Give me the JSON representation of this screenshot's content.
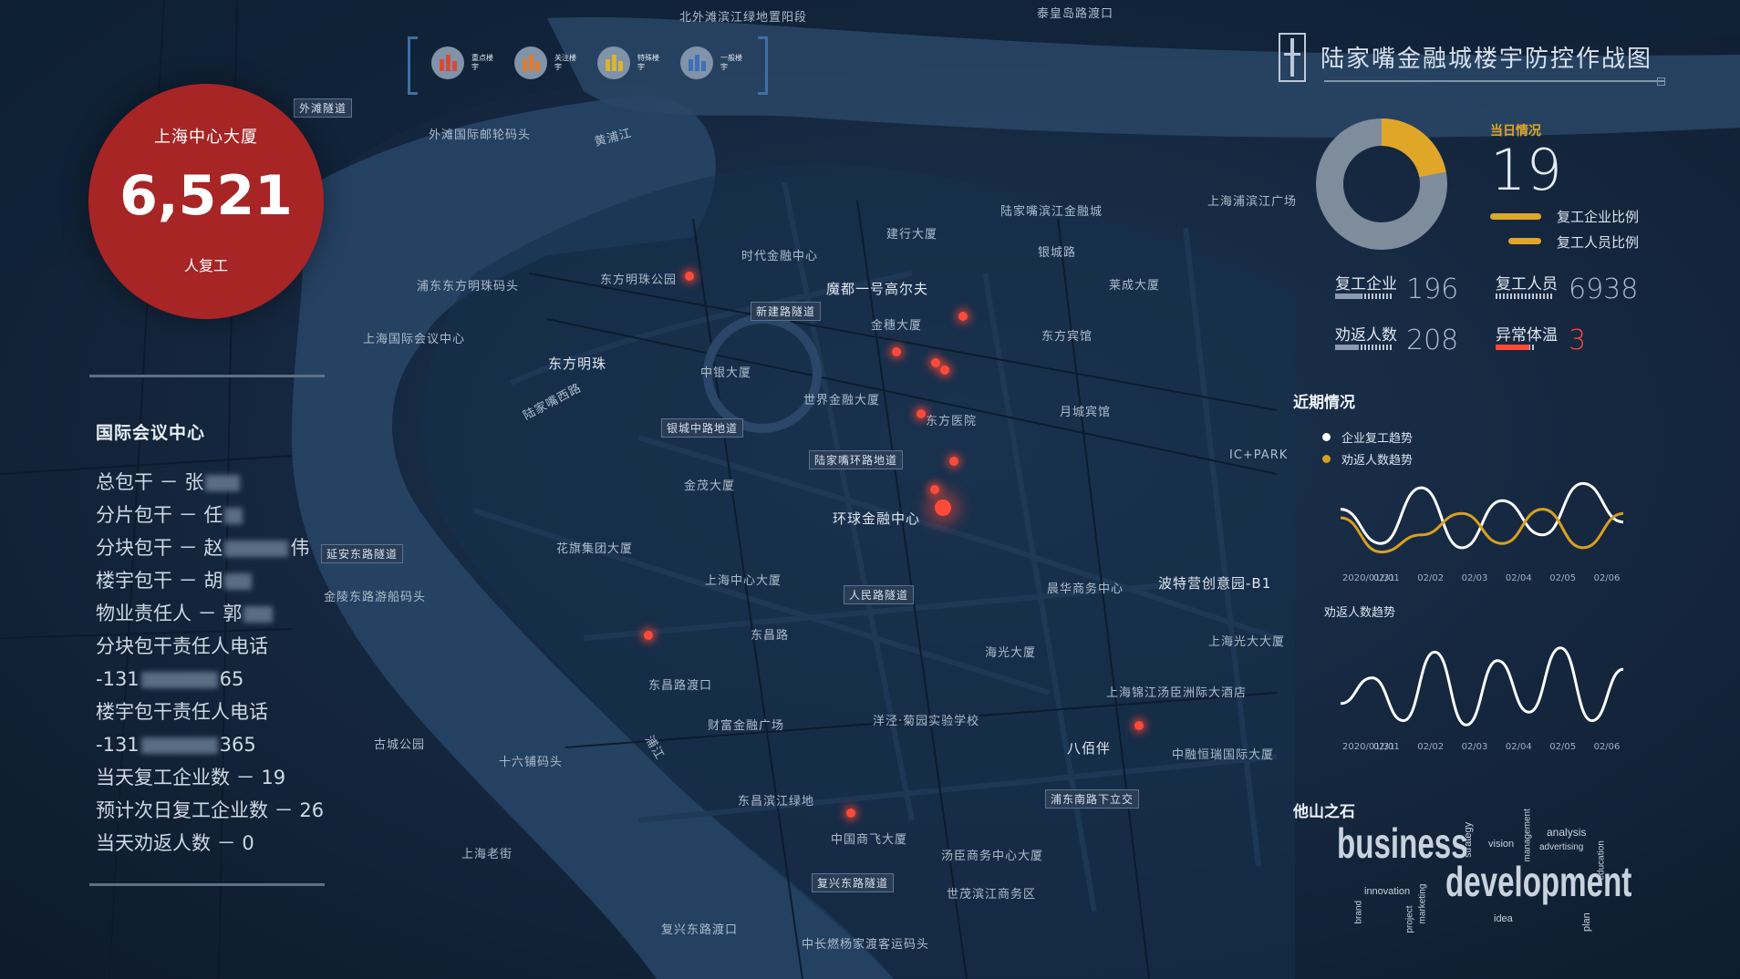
{
  "app_title": "陆家嘴金融城楼宇防控作战图",
  "legend": [
    {
      "label": "重点楼宇",
      "color": "#d84a3a"
    },
    {
      "label": "关注楼宇",
      "color": "#e07a2e"
    },
    {
      "label": "特殊楼宇",
      "color": "#d9b52c"
    },
    {
      "label": "一般楼宇",
      "color": "#3f6fb8"
    }
  ],
  "building_summary": {
    "name": "上海中心大厦",
    "count": "6,521",
    "count_label": "人复工"
  },
  "left_info": {
    "title": "国际会议中心",
    "lines": [
      "总包干 － 张",
      "分片包干 － 任",
      "分块包干 － 赵",
      "伟",
      "楼宇包干 － 胡",
      "物业责任人 － 郭",
      "分块包干责任人电话",
      "-131",
      "65",
      "楼宇包干责任人电话",
      "-131",
      "365",
      "当天复工企业数 － 19",
      "预计次日复工企业数 － 26",
      "当天劝返人数 － 0"
    ]
  },
  "today": {
    "title": "当日情况",
    "count": "19",
    "legend1": "复工企业比例",
    "legend2": "复工人员比例",
    "donut_fraction": 0.22
  },
  "stats": [
    {
      "label": "复工企业",
      "value": "196",
      "fill": 0.45,
      "alert": false
    },
    {
      "label": "复工人员",
      "value": "6938",
      "fill": 0.0,
      "alert": false
    },
    {
      "label": "劝返人数",
      "value": "208",
      "fill": 0.4,
      "alert": false
    },
    {
      "label": "异常体温",
      "value": "3",
      "fill": 0.85,
      "alert": true
    }
  ],
  "recent": {
    "title": "近期情况",
    "legend1": "企业复工趋势",
    "legend2": "劝返人数趋势",
    "chart1_caption": "劝返人数趋势",
    "x_labels": [
      "2020/01/31",
      "02/01",
      "02/02",
      "02/03",
      "02/04",
      "02/05",
      "02/06"
    ]
  },
  "chart_data": [
    {
      "type": "line",
      "categories": [
        "2020/01/31",
        "02/01",
        "02/02",
        "02/03",
        "02/04",
        "02/05",
        "02/06"
      ],
      "series": [
        {
          "name": "企业复工趋势",
          "color": "#ffffff",
          "values": [
            60,
            20,
            85,
            15,
            70,
            30,
            90,
            45
          ]
        },
        {
          "name": "劝返人数趋势",
          "color": "#d9a020",
          "values": [
            50,
            10,
            30,
            55,
            20,
            60,
            15,
            55
          ]
        }
      ]
    },
    {
      "type": "line",
      "categories": [
        "2020/01/31",
        "02/01",
        "02/02",
        "02/03",
        "02/04",
        "02/05",
        "02/06"
      ],
      "series": [
        {
          "name": "",
          "color": "#ffffff",
          "values": [
            30,
            60,
            10,
            90,
            5,
            80,
            20,
            95,
            10,
            70
          ]
        }
      ]
    }
  ],
  "wisdom": {
    "title": "他山之石",
    "words": [
      "business",
      "development",
      "strategy",
      "vision",
      "management",
      "analysis",
      "advertising",
      "innovation",
      "brand",
      "marketing",
      "project",
      "idea",
      "plan",
      "education"
    ]
  },
  "map_labels": [
    "北外滩滨江绿地置阳段",
    "泰皇岛路渡口",
    "外滩隧道",
    "外滩国际邮轮码头",
    "浦东东方明珠码头",
    "东方明珠公园",
    "上海国际会议中心",
    "东方明珠",
    "陆家嘴西路",
    "时代金融中心",
    "新建路隧道",
    "魔都一号高尔夫",
    "金穗大厦",
    "建行大厦",
    "陆家嘴滨江金融城",
    "银城路",
    "莱成大厦",
    "上海浦滨江广场",
    "东方宾馆",
    "世界金融大厦",
    "东方医院",
    "月城宾馆",
    "中银大厦",
    "银城中路地道",
    "陆家嘴环路地道",
    "金茂大厦",
    "环球金融中心",
    "上海中心大厦",
    "花旗集团大厦",
    "人民路隧道",
    "晨华商务中心",
    "波特营创意园-B1",
    "上海光大大厦",
    "东昌路",
    "东昌路渡口",
    "金陵东路游船码头",
    "延安东路隧道",
    "古城公园",
    "财富金融广场",
    "洋泾·菊园实验学校",
    "海光大厦",
    "上海锦江汤臣洲际大酒店",
    "十六铺码头",
    "东昌滨江绿地",
    "浦东南路下立交",
    "中融恒瑞国际大厦",
    "上海老街",
    "中国商飞大厦",
    "汤臣商务中心大厦",
    "世茂滨江商务区",
    "复兴东路隧道",
    "复兴东路渡口",
    "中长燃杨家渡客运码头",
    "浦江",
    "黄浦江",
    "IC+PARK",
    "八佰伴"
  ]
}
